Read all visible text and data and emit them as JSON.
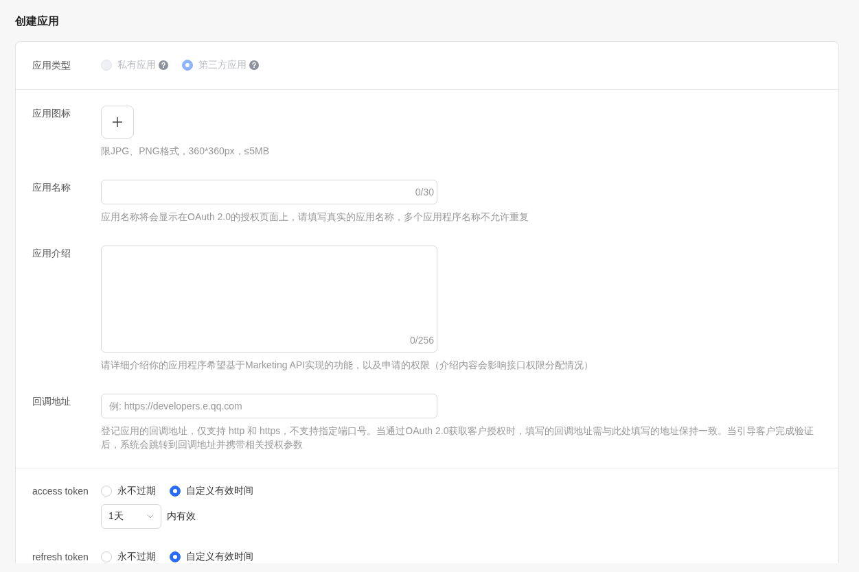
{
  "page_title": "创建应用",
  "app_type": {
    "label": "应用类型",
    "disabled": true,
    "options": [
      {
        "label": "私有应用",
        "selected": false
      },
      {
        "label": "第三方应用",
        "selected": true
      }
    ]
  },
  "fields": [
    {
      "kind": "upload",
      "label": "应用图标",
      "hint": "限JPG、PNG格式，360*360px，≤5MB"
    },
    {
      "kind": "input",
      "label": "应用名称",
      "counter": "0/30",
      "hint": "应用名称将会显示在OAuth 2.0的授权页面上，请填写真实的应用名称，多个应用程序名称不允许重复"
    },
    {
      "kind": "textarea",
      "label": "应用介绍",
      "counter": "0/256",
      "hint": "请详细介绍你的应用程序希望基于Marketing API实现的功能，以及申请的权限（介绍内容会影响接口权限分配情况）"
    },
    {
      "kind": "input",
      "label": "回调地址",
      "placeholder": "例: https://developers.e.qq.com",
      "hint": "登记应用的回调地址，仅支持 http 和 https，不支持指定端口号。当通过OAuth 2.0获取客户授权时，填写的回调地址需与此处填写的地址保持一致。当引导客户完成验证后，系统会跳转到回调地址并携带相关授权参数"
    }
  ],
  "tokens": [
    {
      "label": "access token",
      "options": [
        {
          "label": "永不过期",
          "selected": false
        },
        {
          "label": "自定义有效时间",
          "selected": true
        }
      ],
      "duration": {
        "value": "1天",
        "suffix": "内有效"
      }
    },
    {
      "label": "refresh token",
      "options": [
        {
          "label": "永不过期",
          "selected": false
        },
        {
          "label": "自定义有效时间",
          "selected": true
        }
      ]
    }
  ]
}
